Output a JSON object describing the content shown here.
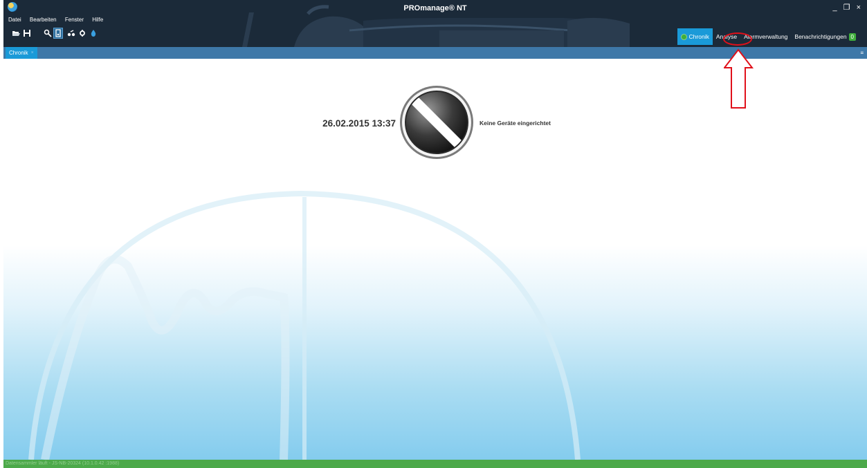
{
  "window": {
    "title": "PROmanage® NT",
    "controls": {
      "minimize": "_",
      "restore": "š",
      "close": "×"
    }
  },
  "menu": {
    "items": [
      {
        "label": "Datei"
      },
      {
        "label": "Bearbeiten"
      },
      {
        "label": "Fenster"
      },
      {
        "label": "Hilfe"
      }
    ]
  },
  "toolbar": {
    "icons": [
      "open-folder-icon",
      "save-icon",
      "zoom-icon",
      "select-device-icon",
      "connect-icon",
      "settings-icon",
      "droplet-icon"
    ]
  },
  "nav": {
    "tabs": [
      {
        "label": "Chronik",
        "active": true
      },
      {
        "label": "Analyse",
        "active": false
      },
      {
        "label": "Alarmverwaltung",
        "active": false
      },
      {
        "label": "Benachrichtigungen",
        "active": false,
        "badge": "0"
      }
    ]
  },
  "doc_tabs": [
    {
      "label": "Chronik",
      "close": "×"
    }
  ],
  "tabstrip": {
    "menu_glyph": "≡"
  },
  "content": {
    "timestamp": "26.02.2015 13:37",
    "status_message": "Keine Geräte eingerichtet",
    "status_icon": "no-devices-prohibited-icon"
  },
  "statusbar": {
    "text": "Datensammler läuft - JS-NB-20324 (10.1.0.42 :1988)"
  },
  "colors": {
    "titlebar_bg": "#1b2a39",
    "accent": "#1a9ad8",
    "tabstrip": "#3e78a8",
    "statusbar": "#4ca94a",
    "annotation": "#e0101a"
  }
}
